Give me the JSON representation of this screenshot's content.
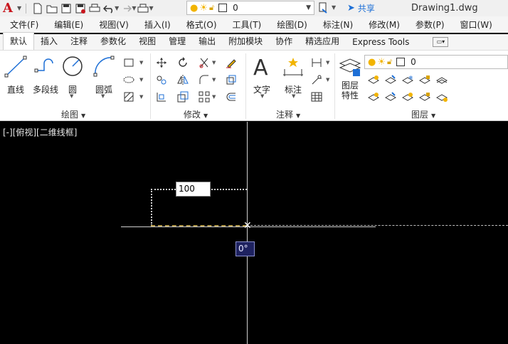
{
  "titlebar": {
    "app_logo": "A",
    "layer_value": "0",
    "share_label": "共享",
    "document_title": "Drawing1.dwg"
  },
  "menu": [
    "文件(F)",
    "编辑(E)",
    "视图(V)",
    "插入(I)",
    "格式(O)",
    "工具(T)",
    "绘图(D)",
    "标注(N)",
    "修改(M)",
    "参数(P)",
    "窗口(W)"
  ],
  "ribbon_tabs": [
    "默认",
    "插入",
    "注释",
    "参数化",
    "视图",
    "管理",
    "输出",
    "附加模块",
    "协作",
    "精选应用",
    "Express Tools"
  ],
  "active_tab": "默认",
  "ribbon": {
    "draw": {
      "title": "绘图",
      "line": "直线",
      "polyline": "多段线",
      "circle": "圆",
      "arc": "圆弧"
    },
    "modify": {
      "title": "修改"
    },
    "annotation": {
      "title": "注释",
      "text": "文字",
      "dimension": "标注"
    },
    "layers": {
      "title": "图层",
      "layer_props_1": "图层",
      "layer_props_2": "特性",
      "current_layer": "0"
    }
  },
  "canvas": {
    "viewport_label": "[-][俯视][二维线框]",
    "dim_input_value": "100",
    "angle_tooltip": "0°"
  },
  "colors": {
    "logo_red": "#c8161d",
    "share_blue": "#1d6fd6",
    "canvas_bg": "#000000",
    "tooltip_bg": "#1e2260"
  }
}
